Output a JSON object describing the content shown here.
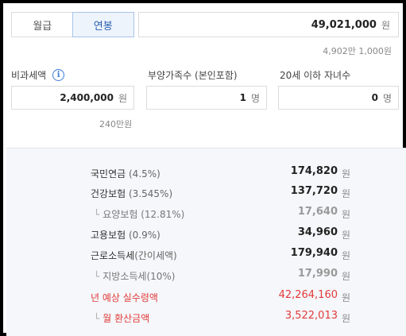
{
  "tabs": [
    {
      "label": "월급",
      "active": false
    },
    {
      "label": "연봉",
      "active": true
    }
  ],
  "salary": {
    "value": "49,021,000",
    "unit": "원",
    "hint": "4,902만 1,000원"
  },
  "non_taxable": {
    "label": "비과세액",
    "info_icon": "i",
    "value": "2,400,000",
    "unit": "원",
    "hint": "240만원"
  },
  "dependents": {
    "label": "부양가족수 (본인포함)",
    "value": "1",
    "unit": "명"
  },
  "children": {
    "label": "20세 이하 자녀수",
    "value": "0",
    "unit": "명"
  },
  "results": [
    {
      "name": "국민연금",
      "pct": "(4.5%)",
      "amount": "174,820",
      "unit": "원",
      "kind": "main"
    },
    {
      "name": "건강보험",
      "pct": "(3.545%)",
      "amount": "137,720",
      "unit": "원",
      "kind": "main"
    },
    {
      "name": "요양보험",
      "pct": "(12.81%)",
      "amount": "17,640",
      "unit": "원",
      "kind": "sub"
    },
    {
      "name": "고용보험",
      "pct": "(0.9%)",
      "amount": "34,960",
      "unit": "원",
      "kind": "main"
    },
    {
      "name": "근로소득세",
      "pct": "(간이세액)",
      "amount": "179,940",
      "unit": "원",
      "kind": "main"
    },
    {
      "name": "지방소득세",
      "pct": "(10%)",
      "amount": "17,990",
      "unit": "원",
      "kind": "sub"
    },
    {
      "name": "년 예상 실수령액",
      "pct": "",
      "amount": "42,264,160",
      "unit": "원",
      "kind": "red"
    },
    {
      "name": "월 환산금액",
      "pct": "",
      "amount": "3,522,013",
      "unit": "원",
      "kind": "red-sub"
    }
  ],
  "colors": {
    "accent": "#2a5fb0",
    "highlight_red": "#e23a3a",
    "panel_bg": "#f5f7fa"
  }
}
